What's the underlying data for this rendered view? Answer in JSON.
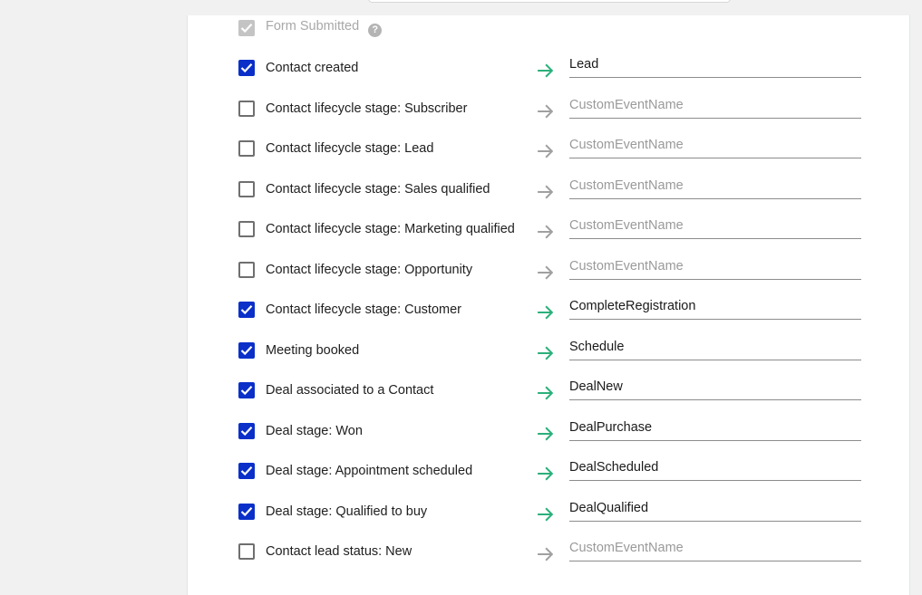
{
  "colors": {
    "checkbox_checked": "#0a30c9",
    "checkbox_disabled": "#c4c4c4",
    "arrow_active": "#2bb07a",
    "arrow_inactive": "#a0a0a0"
  },
  "form_submitted": {
    "label": "Form Submitted",
    "checked": true,
    "disabled": true,
    "help_icon": "question-circle-icon",
    "help_glyph": "?"
  },
  "mappings": [
    {
      "label": "Contact created",
      "checked": true,
      "value": "Lead",
      "placeholder": "CustomEventName"
    },
    {
      "label": "Contact lifecycle stage: Subscriber",
      "checked": false,
      "value": "",
      "placeholder": "CustomEventName"
    },
    {
      "label": "Contact lifecycle stage: Lead",
      "checked": false,
      "value": "",
      "placeholder": "CustomEventName"
    },
    {
      "label": "Contact lifecycle stage: Sales qualified",
      "checked": false,
      "value": "",
      "placeholder": "CustomEventName"
    },
    {
      "label": "Contact lifecycle stage: Marketing qualified",
      "checked": false,
      "value": "",
      "placeholder": "CustomEventName"
    },
    {
      "label": "Contact lifecycle stage: Opportunity",
      "checked": false,
      "value": "",
      "placeholder": "CustomEventName"
    },
    {
      "label": "Contact lifecycle stage: Customer",
      "checked": true,
      "value": "CompleteRegistration",
      "placeholder": "CustomEventName"
    },
    {
      "label": "Meeting booked",
      "checked": true,
      "value": "Schedule",
      "placeholder": "CustomEventName"
    },
    {
      "label": "Deal associated to a Contact",
      "checked": true,
      "value": "DealNew",
      "placeholder": "CustomEventName"
    },
    {
      "label": "Deal stage: Won",
      "checked": true,
      "value": "DealPurchase",
      "placeholder": "CustomEventName"
    },
    {
      "label": "Deal stage: Appointment scheduled",
      "checked": true,
      "value": "DealScheduled",
      "placeholder": "CustomEventName"
    },
    {
      "label": "Deal stage: Qualified to buy",
      "checked": true,
      "value": "DealQualified",
      "placeholder": "CustomEventName"
    },
    {
      "label": "Contact lead status: New",
      "checked": false,
      "value": "",
      "placeholder": "CustomEventName"
    }
  ]
}
